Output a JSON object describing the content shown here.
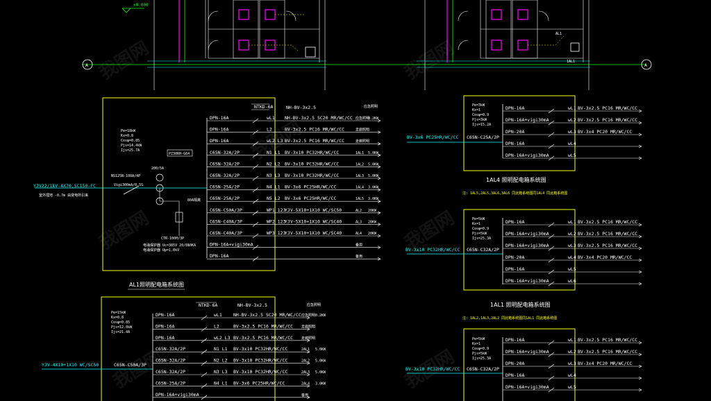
{
  "colors": {
    "frame": "#ffff00",
    "wire": "#ffffff",
    "cyan": "#00ffff",
    "magenta": "#ff00ff",
    "green": "#00ff00",
    "red": "#ff0000"
  },
  "header": {
    "level_mark": "±0.000",
    "axis_label": "A",
    "al1_tag": "AL1",
    "al1_tag2": "1AL1"
  },
  "watermark": "我图网",
  "al1": {
    "params": [
      "Pe=18kW",
      "Kx=0.8",
      "Cosφ=0.85",
      "Pjs=14.4kW",
      "Ijs=25.7A"
    ],
    "cabinet": "PZ30RH-G64",
    "incoming": "YJV22/1kV-4X70,SC150-FC",
    "incoming_sub": "室外埋地 -0.7m 由变电所引来",
    "main_switch": "NS125N-100A/4P",
    "main_switch2": "Vigi300mA/0.5S",
    "meter": "200/5A",
    "breaker": "80A隔离",
    "spd": "CTR-100H/3P",
    "spd_note1": "电涌保护器 Uc=385V 20/8s",
    "spd_note2": "电涌保护器 Up=1.0kV",
    "spd_note3": "10KA",
    "box_top": "NTKD-6A",
    "first_cable": "NH-BV-3x2.5",
    "first_use": "应急照明",
    "title": "AL1照明配电箱系统图",
    "circuits": [
      {
        "breaker": "DPN-16A",
        "phase": "wL1",
        "cable": "NH-BV-3x2.5 SC20 MR/WC/CC",
        "load": "应急照明",
        "power": "0.2KW"
      },
      {
        "breaker": "DPN-16A",
        "phase": "L2",
        "cable": "BV-3x2.5 PC16 MR/WC/CC",
        "load": "走廊照明",
        "power": ""
      },
      {
        "breaker": "DPN-16A",
        "phase": "wL2 L3",
        "cable": "BV-3x2.5 PC16 MR/WC/CC",
        "load": "走廊照明",
        "power": ""
      },
      {
        "breaker": "C65N-32A/2P",
        "phase": "N1 L1",
        "cable": "BV-3x10 PC32HR/WC/CC",
        "load": "1AL1",
        "power": "5.0KW"
      },
      {
        "breaker": "C65N-32A/2P",
        "phase": "N2 L2",
        "cable": "BV-3x10 PC32HR/WC/CC",
        "load": "1AL2",
        "power": "5.0KW"
      },
      {
        "breaker": "C65N-32A/2P",
        "phase": "N3 L3",
        "cable": "BV-3x10 PC32HR/WC/CC",
        "load": "1AL3",
        "power": "5.0KW"
      },
      {
        "breaker": "C65N-25A/2P",
        "phase": "N4 L1",
        "cable": "BV-3x6 PC25HR/WC/CC",
        "load": "1AL4",
        "power": "3.0KW"
      },
      {
        "breaker": "C65N-25A/2P",
        "phase": "N5 L2",
        "cable": "BV-3x6 PC25HR/WC/CC",
        "load": "1AL5",
        "power": "3.0KW"
      },
      {
        "breaker": "C65N-C50A/3P",
        "phase": "WP1 123",
        "cable": "YJV-5X10+1X10 WC/SC50",
        "load": "AL2",
        "power": "20KW"
      },
      {
        "breaker": "C65N-C40A/3P",
        "phase": "WP2 123",
        "cable": "YJV-5X10+1X10 WC/SC40",
        "load": "AL3",
        "power": "20KW"
      },
      {
        "breaker": "C65N-C40A/3P",
        "phase": "WP3 123",
        "cable": "YJV-5X10+1X10 WC/SC40",
        "load": "AL4",
        "power": "20KW"
      },
      {
        "breaker": "DPN-16A+vigi30mA",
        "phase": "",
        "cable": "",
        "load": "备用",
        "power": ""
      },
      {
        "breaker": "DPN-16A",
        "phase": "",
        "cable": "",
        "load": "备用",
        "power": ""
      }
    ]
  },
  "al2": {
    "params": [
      "Pe=15kW",
      "Kx=0.8",
      "Cosφ=0.85",
      "Pjs=12.0kW",
      "Ijs=21.4A"
    ],
    "incoming": "YJV-4X10+1X10 WC/SC50",
    "main": "C65N-C50A/3P",
    "box_top": "NTKD-6A",
    "first_cable": "NH-BV-3x2.5",
    "first_use": "应急照明",
    "circuits": [
      {
        "breaker": "DPN-16A",
        "phase": "wL1",
        "cable": "NH-BV-3x2.5 SC20 MR/WC/CC",
        "load": "应急照明",
        "power": "0.2KW"
      },
      {
        "breaker": "DPN-16A",
        "phase": "L2",
        "cable": "BV-3x2.5 PC16 MR/WC/CC",
        "load": "走廊照明",
        "power": ""
      },
      {
        "breaker": "DPN-16A",
        "phase": "wL2 L3",
        "cable": "BV-3x2.5 PC16 MR/WC/CC",
        "load": "走廊照明",
        "power": ""
      },
      {
        "breaker": "C65N-32A/2P",
        "phase": "N1 L1",
        "cable": "BV-3x10 PC32HR/WC/CC",
        "load": "2AL1",
        "power": "5.0KW"
      },
      {
        "breaker": "C65N-32A/2P",
        "phase": "N2 L2",
        "cable": "BV-3x10 PC32HR/WC/CC",
        "load": "2AL2",
        "power": "5.0KW"
      },
      {
        "breaker": "C65N-32A/2P",
        "phase": "N3 L3",
        "cable": "BV-3x10 PC32HR/WC/CC",
        "load": "2AL3",
        "power": "5.0KW"
      },
      {
        "breaker": "C65N-25A/2P",
        "phase": "N4 L1",
        "cable": "BV-3x6 PC25HR/WC/CC",
        "load": "2AL4",
        "power": "3.0KW"
      },
      {
        "breaker": "DPN-16A+vigi30mA",
        "phase": "",
        "cable": "",
        "load": "备用",
        "power": ""
      }
    ]
  },
  "r1": {
    "params": [
      "Pe=3kW",
      "Kx=1",
      "Cosφ=0.9",
      "Pjs=3kW",
      "Ijs=15.2A"
    ],
    "incoming": "BV-3x6 PC25HR/WC/CC",
    "main": "C65N-C25A/2P",
    "title": "1AL4 照明配电箱系统图",
    "note": "注: 1AL5,2AL5,3AL6,3AL6 同此箱系统图同1AL4 同此箱系统图",
    "circuits": [
      {
        "breaker": "DPN-16A",
        "phase": "wL1",
        "cable": "BV-3x2.5 PC16 MR/WC/CC"
      },
      {
        "breaker": "DPN-16A+vigi30mA",
        "phase": "wL2",
        "cable": "BV-3x2.5 PC16 MR/WC/CC"
      },
      {
        "breaker": "DPN-20A",
        "phase": "wL3",
        "cable": "BV-3x4 PC20 MR/WC/CC"
      },
      {
        "breaker": "DPN-16A",
        "phase": "wL4",
        "cable": ""
      },
      {
        "breaker": "DPN-16A+vigi30mA",
        "phase": "wL5",
        "cable": ""
      }
    ]
  },
  "r2": {
    "params": [
      "Pe=5kW",
      "Kx=1",
      "Cosφ=0.9",
      "Pjs=5kW",
      "Ijs=25.3A"
    ],
    "incoming": "BV-3x10 PC32HR/WC/CC",
    "main": "C65N-C32A/2P",
    "title": "1AL1 照明配电箱系统图",
    "note": "注: 1AL2,1AL3,2AL2 同此箱系统图同1AL1 同此箱系统图",
    "circuits": [
      {
        "breaker": "DPN-16A",
        "phase": "wL1",
        "cable": "BV-3x2.5 PC16 MR/WC/CC"
      },
      {
        "breaker": "DPN-16A+vigi30mA",
        "phase": "wL2",
        "cable": "BV-3x2.5 PC16 MR/WC/CC"
      },
      {
        "breaker": "DPN-16A+vigi30mA",
        "phase": "wL3",
        "cable": "BV-3x2.5 PC16 MR/WC/CC"
      },
      {
        "breaker": "DPN-20A",
        "phase": "wL4",
        "cable": "BV-3x4 PC20 MR/WC/CC"
      },
      {
        "breaker": "DPN-16A",
        "phase": "wL5",
        "cable": ""
      },
      {
        "breaker": "DPN-16A+vigi30mA",
        "phase": "wL6",
        "cable": ""
      }
    ]
  },
  "r3": {
    "params": [
      "Pe=5kW",
      "Kx=1",
      "Cosφ=0.9",
      "Pjs=5kW",
      "Ijs=25.3A"
    ],
    "incoming": "BV-3x10 PC32HR/WC/CC",
    "main": "C65N-C32A/2P",
    "circuits": [
      {
        "breaker": "DPN-16A",
        "phase": "wL1",
        "cable": "BV-3x2.5 PC16 MR/WC/CC"
      },
      {
        "breaker": "DPN-16A+vigi30mA",
        "phase": "wL2",
        "cable": "BV-3x2.5 PC16 MR/WC/CC"
      },
      {
        "breaker": "DPN-20A",
        "phase": "wL3",
        "cable": "BV-3x4 PC20 MR/WC/CC"
      },
      {
        "breaker": "DPN-16A",
        "phase": "wL4",
        "cable": ""
      },
      {
        "breaker": "DPN-16A+vigi30mA",
        "phase": "wL5",
        "cable": ""
      }
    ]
  }
}
